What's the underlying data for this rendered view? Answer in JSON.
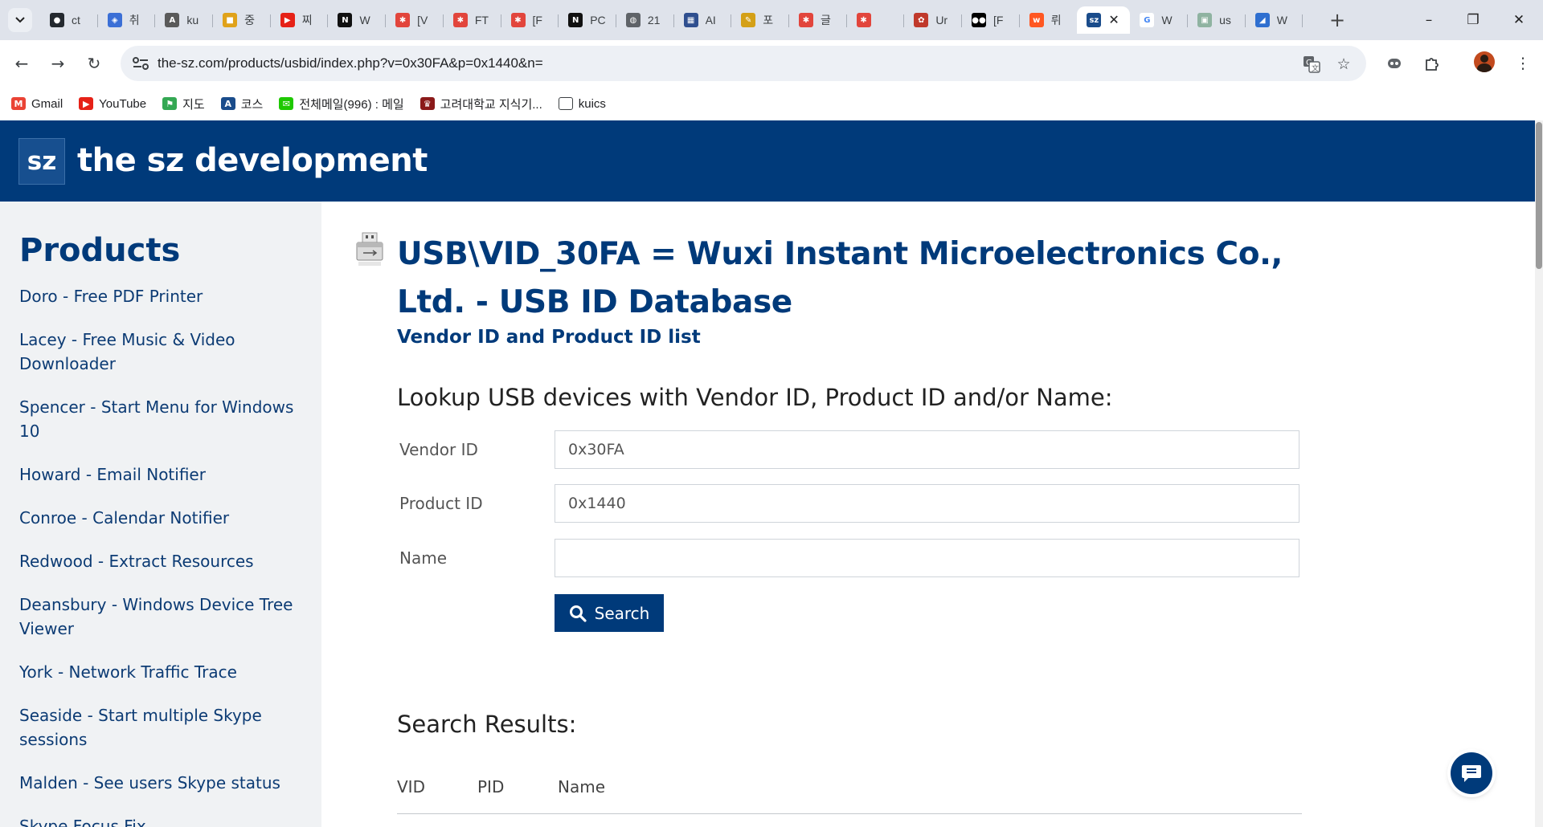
{
  "browser": {
    "tabs": [
      {
        "icon": "github-icon",
        "title": "ct",
        "color": "#24292f",
        "glyph": "●"
      },
      {
        "icon": "shield-icon",
        "title": "취",
        "color": "#3b6fd6",
        "glyph": "◈"
      },
      {
        "icon": "a-logo-icon",
        "title": "ku",
        "color": "#5a5a5a",
        "glyph": "A"
      },
      {
        "icon": "lock-icon",
        "title": "중",
        "color": "#e0a21a",
        "glyph": "■"
      },
      {
        "icon": "youtube-icon",
        "title": "찌",
        "color": "#e62117",
        "glyph": "▶"
      },
      {
        "icon": "notion-icon",
        "title": "W",
        "color": "#111111",
        "glyph": "N"
      },
      {
        "icon": "red-logo-icon",
        "title": "[V",
        "color": "#e2453c",
        "glyph": "✱"
      },
      {
        "icon": "red-logo-icon",
        "title": "FT",
        "color": "#e2453c",
        "glyph": "✱"
      },
      {
        "icon": "red-logo-icon",
        "title": "[F",
        "color": "#e2453c",
        "glyph": "✱"
      },
      {
        "icon": "notion-icon",
        "title": "PC",
        "color": "#111111",
        "glyph": "N"
      },
      {
        "icon": "globe-icon",
        "title": "21",
        "color": "#5f6368",
        "glyph": "◍"
      },
      {
        "icon": "ai-icon",
        "title": "AI",
        "color": "#2f4f8f",
        "glyph": "▦"
      },
      {
        "icon": "pencil-icon",
        "title": "포",
        "color": "#d4a017",
        "glyph": "✎"
      },
      {
        "icon": "red-logo-icon",
        "title": "글",
        "color": "#e2453c",
        "glyph": "✱"
      },
      {
        "icon": "red-logo-icon",
        "title": "",
        "color": "#e2453c",
        "glyph": "✱"
      },
      {
        "icon": "figure-icon",
        "title": "Ur",
        "color": "#c0392b",
        "glyph": "✿"
      },
      {
        "icon": "medium-icon",
        "title": "[F",
        "color": "#000000",
        "glyph": "●●"
      },
      {
        "icon": "w-logo-icon",
        "title": "뤼",
        "color": "#ff5722",
        "glyph": "w"
      },
      {
        "icon": "sz-icon",
        "title": "",
        "color": "#1a4c8b",
        "glyph": "sz",
        "active": true
      },
      {
        "icon": "google-icon",
        "title": "W",
        "color": "#ffffff",
        "glyph": "G"
      },
      {
        "icon": "image-icon",
        "title": "us",
        "color": "#8fb3a1",
        "glyph": "▣"
      },
      {
        "icon": "wing-icon",
        "title": "W",
        "color": "#2f6fd0",
        "glyph": "◢"
      }
    ],
    "url": "the-sz.com/products/usbid/index.php?v=0x30FA&p=0x1440&n=",
    "bookmarks": [
      {
        "icon": "gmail-icon",
        "label": "Gmail",
        "color": "#ea4335",
        "glyph": "M"
      },
      {
        "icon": "youtube-icon",
        "label": "YouTube",
        "color": "#e62117",
        "glyph": "▶"
      },
      {
        "icon": "maps-icon",
        "label": "지도",
        "color": "#34a853",
        "glyph": "⚑"
      },
      {
        "icon": "a-logo-icon",
        "label": "코스",
        "color": "#1a4c8b",
        "glyph": "A"
      },
      {
        "icon": "mail-icon",
        "label": "전체메일(996) : 메일",
        "color": "#1ec800",
        "glyph": "✉"
      },
      {
        "icon": "crest-icon",
        "label": "고려대학교 지식기...",
        "color": "#8b1a1a",
        "glyph": "♛"
      },
      {
        "icon": "folder-icon",
        "label": "kuics",
        "color": "#ffffff",
        "glyph": "▭"
      }
    ]
  },
  "site": {
    "logo_text": "sz",
    "name": "the sz development"
  },
  "sidebar": {
    "heading": "Products",
    "items": [
      "Doro - Free PDF Printer",
      "Lacey - Free Music & Video Downloader",
      "Spencer - Start Menu for Windows 10",
      "Howard - Email Notifier",
      "Conroe - Calendar Notifier",
      "Redwood - Extract Resources",
      "Deansbury - Windows Device Tree Viewer",
      "York - Network Traffic Trace",
      "Seaside - Start multiple Skype sessions",
      "Malden - See users Skype status",
      "Skype Focus Fix"
    ]
  },
  "main": {
    "title": "USB\\VID_30FA = Wuxi Instant Microelectronics Co., Ltd. - USB ID Database",
    "subtitle": "Vendor ID and Product ID list",
    "lookup_heading": "Lookup USB devices with Vendor ID, Product ID and/or Name:",
    "form": {
      "vendor_label": "Vendor ID",
      "vendor_value": "0x30FA",
      "product_label": "Product ID",
      "product_value": "0x1440",
      "name_label": "Name",
      "name_value": ""
    },
    "search_label": "Search",
    "results_heading": "Search Results:",
    "columns": [
      "VID",
      "PID",
      "Name"
    ]
  }
}
